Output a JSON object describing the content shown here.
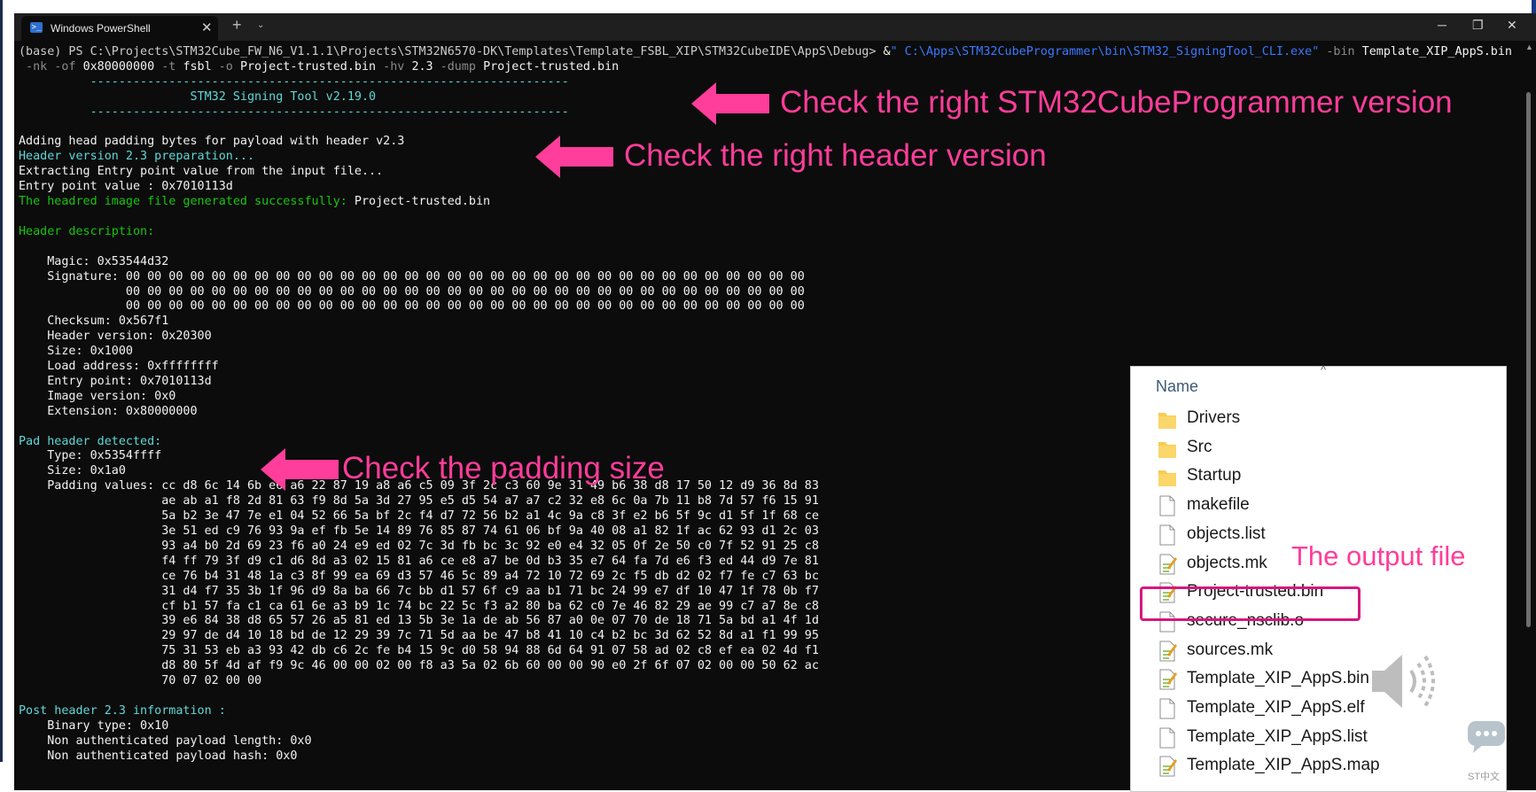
{
  "window": {
    "tab_title": "Windows PowerShell",
    "ps_glyph": ">_",
    "close_glyph": "✕",
    "new_tab_glyph": "+",
    "tab_dropdown_glyph": "⌄",
    "minimize_glyph": "─",
    "maximize_glyph": "❐",
    "window_close_glyph": "✕",
    "scroll_up_glyph": "▲"
  },
  "terminal": {
    "prompt": "(base) PS C:\\Projects\\STM32Cube_FW_N6_V1.1.1\\Projects\\STM32N6570-DK\\Templates\\Template_FSBL_XIP\\STM32CubeIDE\\AppS\\Debug> ",
    "cmd_amp": "&",
    "cmd_exe": "\" C:\\Apps\\STM32CubeProgrammer\\bin\\STM32_SigningTool_CLI.exe\"",
    "cmd_bin_flag": " -bin ",
    "cmd_bin_file": "Template_XIP_AppS.bin",
    "cmd_line2_a": " -nk -of ",
    "cmd_line2_b": "0x80000000",
    "cmd_line2_c": " -t ",
    "cmd_line2_d": "fsbl",
    "cmd_line2_e": " -o ",
    "cmd_line2_f": "Project-trusted.bin",
    "cmd_line2_g": " -hv ",
    "cmd_line2_h": "2.3",
    "cmd_line2_i": " -dump ",
    "cmd_line2_j": "Project-trusted.bin",
    "rule": "          -------------------------------------------------------------------",
    "banner": "                        STM32 Signing Tool v2.19.0",
    "l_adding": "Adding head padding bytes for payload with header v2.3",
    "l_prep": "Header version 2.3 preparation...",
    "l_extract": "Extracting Entry point value from the input file...",
    "l_entry": "Entry point value : 0x7010113d",
    "l_gen": "The headred image file generated successfully: ",
    "l_gen_file": "Project-trusted.bin",
    "l_hdr_desc": "Header description:",
    "hdr_lines": [
      "    Magic: 0x53544d32",
      "    Signature: 00 00 00 00 00 00 00 00 00 00 00 00 00 00 00 00 00 00 00 00 00 00 00 00 00 00 00 00 00 00 00 00",
      "               00 00 00 00 00 00 00 00 00 00 00 00 00 00 00 00 00 00 00 00 00 00 00 00 00 00 00 00 00 00 00 00",
      "               00 00 00 00 00 00 00 00 00 00 00 00 00 00 00 00 00 00 00 00 00 00 00 00 00 00 00 00 00 00 00 00",
      "    Checksum: 0x567f1",
      "    Header version: 0x20300",
      "    Size: 0x1000",
      "    Load address: 0xffffffff",
      "    Entry point: 0x7010113d",
      "    Image version: 0x0",
      "    Extension: 0x80000000"
    ],
    "l_pad_detect": "Pad header detected:",
    "pad_lines": [
      "    Type: 0x5354ffff",
      "    Size: 0x1a0",
      "    Padding values: cc d8 6c 14 6b e6 a6 22 87 19 a8 a6 c5 09 3f 2c c3 60 9e 31 49 b6 38 d8 17 50 12 d9 36 8d 83",
      "                    ae ab a1 f8 2d 81 63 f9 8d 5a 3d 27 95 e5 d5 54 a7 a7 c2 32 e8 6c 0a 7b 11 b8 7d 57 f6 15 91",
      "                    5a b2 3e 47 7e e1 04 52 66 5a bf 2c f4 d7 72 56 b2 a1 4c 9a c8 3f e2 b6 5f 9c d1 5f 1f 68 ce",
      "                    3e 51 ed c9 76 93 9a ef fb 5e 14 89 76 85 87 74 61 06 bf 9a 40 08 a1 82 1f ac 62 93 d1 2c 03",
      "                    93 a4 b0 2d 69 23 f6 a0 24 e9 ed 02 7c 3d fb bc 3c 92 e0 e4 32 05 0f 2e 50 c0 7f 52 91 25 c8",
      "                    f4 ff 79 3f d9 c1 d6 8d a3 02 15 81 a6 ce e8 a7 be 0d b3 35 e7 64 fa 7d e6 f3 ed 44 d9 7e 81",
      "                    ce 76 b4 31 48 1a c3 8f 99 ea 69 d3 57 46 5c 89 a4 72 10 72 69 2c f5 db d2 02 f7 fe c7 63 bc",
      "                    31 d4 f7 35 3b 1f 96 d9 8a ba 66 7c bb d1 57 6f c9 aa b1 71 bc 24 99 e7 df 10 47 1f 78 0b f7",
      "                    cf b1 57 fa c1 ca 61 6e a3 b9 1c 74 bc 22 5c f3 a2 80 ba 62 c0 7e 46 82 29 ae 99 c7 a7 8e c8",
      "                    39 e6 84 38 d8 65 57 26 a5 81 ed 13 5b 3e 1a de ab 56 87 a0 0e 07 70 de 18 71 5a bd a1 4f 1d",
      "                    29 97 de d4 10 18 bd de 12 29 39 7c 71 5d aa be 47 b8 41 10 c4 b2 bc 3d 62 52 8d a1 f1 99 95",
      "                    75 31 53 eb a3 93 42 db c6 2c fe b4 15 9c d0 58 94 88 6d 64 91 07 58 ad 02 c8 ef ea 02 4d f1",
      "                    d8 80 5f 4d af f9 9c 46 00 00 02 00 f8 a3 5a 02 6b 60 00 00 90 e0 2f 6f 07 02 00 00 50 62 ac",
      "                    70 07 02 00 00"
    ],
    "l_post": "Post header 2.3 information :",
    "post_lines": [
      "    Binary type: 0x10",
      "    Non authenticated payload length: 0x0",
      "    Non authenticated payload hash: 0x0"
    ]
  },
  "annotations": {
    "version": "Check the right STM32CubeProgrammer version",
    "header": "Check the right header version",
    "padding": "Check the padding size",
    "output": "The output file"
  },
  "explorer": {
    "column_header": "Name",
    "sort_glyph": "^",
    "files": [
      {
        "name": "Drivers",
        "icon": "folder-icon"
      },
      {
        "name": "Src",
        "icon": "folder-icon"
      },
      {
        "name": "Startup",
        "icon": "folder-icon"
      },
      {
        "name": "makefile",
        "icon": "file-icon"
      },
      {
        "name": "objects.list",
        "icon": "file-icon"
      },
      {
        "name": "objects.mk",
        "icon": "edit-file-icon"
      },
      {
        "name": "Project-trusted.bin",
        "icon": "edit-file-icon"
      },
      {
        "name": "secure_nsclib.o",
        "icon": "file-icon"
      },
      {
        "name": "sources.mk",
        "icon": "edit-file-icon"
      },
      {
        "name": "Template_XIP_AppS.bin",
        "icon": "edit-file-icon"
      },
      {
        "name": "Template_XIP_AppS.elf",
        "icon": "file-icon"
      },
      {
        "name": "Template_XIP_AppS.list",
        "icon": "file-icon"
      },
      {
        "name": "Template_XIP_AppS.map",
        "icon": "edit-file-icon"
      }
    ],
    "watermark_text": "ST中文"
  },
  "colors": {
    "annotation": "#ff3d9a",
    "highlight_box": "#d6187e",
    "terminal_bg": "#0c0c0c",
    "cyan": "#61d6d6",
    "green": "#16c60c"
  }
}
